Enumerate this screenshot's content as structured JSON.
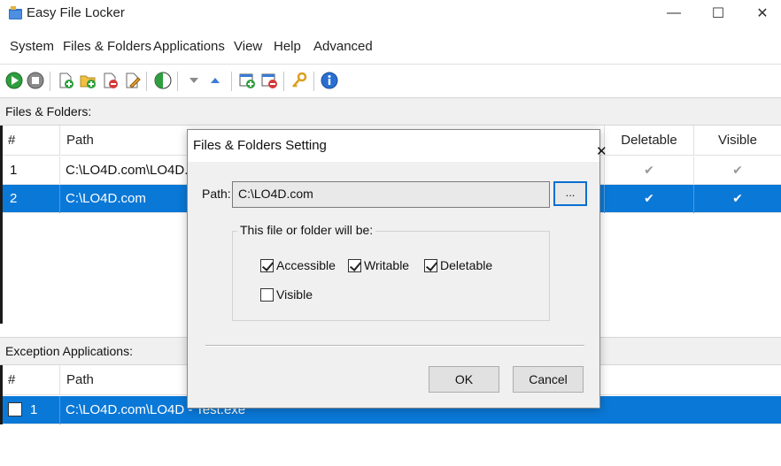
{
  "window": {
    "title": "Easy File Locker",
    "minimize": "—",
    "maximize": "☐",
    "close": "✕"
  },
  "menu": [
    "System",
    "Files & Folders",
    "Applications",
    "View",
    "Help",
    "Advanced"
  ],
  "toolbar": {
    "icons": [
      "start-icon",
      "stop-icon",
      "add-file-icon",
      "add-folder-icon",
      "delete-icon",
      "edit-icon",
      "toggle-icon",
      "move-down-icon",
      "move-up-icon",
      "add-application-icon",
      "remove-application-icon",
      "password-key-icon",
      "about-icon"
    ]
  },
  "files_section": {
    "title": "Files & Folders:",
    "columns": [
      "#",
      "Path",
      "Deletable",
      "Visible"
    ],
    "rows": [
      {
        "num": "1",
        "path": "C:\\LO4D.com\\LO4D.com",
        "deletable": "✔",
        "visible": "✔",
        "selected": false
      },
      {
        "num": "2",
        "path": "C:\\LO4D.com",
        "deletable": "✔",
        "visible": "✔",
        "selected": true
      }
    ]
  },
  "exceptions_section": {
    "title": "Exception Applications:",
    "columns": [
      "#",
      "Path"
    ],
    "rows": [
      {
        "num": "1",
        "path": "C:\\LO4D.com\\LO4D - Test.exe",
        "selected": true
      }
    ]
  },
  "dialog": {
    "title": "Files & Folders Setting",
    "close": "✕",
    "path_label": "Path:",
    "path_value": "C:\\LO4D.com",
    "browse_label": "...",
    "group_label": "This file or folder will be:",
    "options": {
      "accessible": {
        "label": "Accessible",
        "checked": true
      },
      "writable": {
        "label": "Writable",
        "checked": true
      },
      "deletable": {
        "label": "Deletable",
        "checked": true
      },
      "visible": {
        "label": "Visible",
        "checked": false
      }
    },
    "ok_label": "OK",
    "cancel_label": "Cancel"
  },
  "colors": {
    "selection": "#0a78d7",
    "dialog_bg": "#f0f0f0",
    "focus_border": "#0a6fd1"
  }
}
